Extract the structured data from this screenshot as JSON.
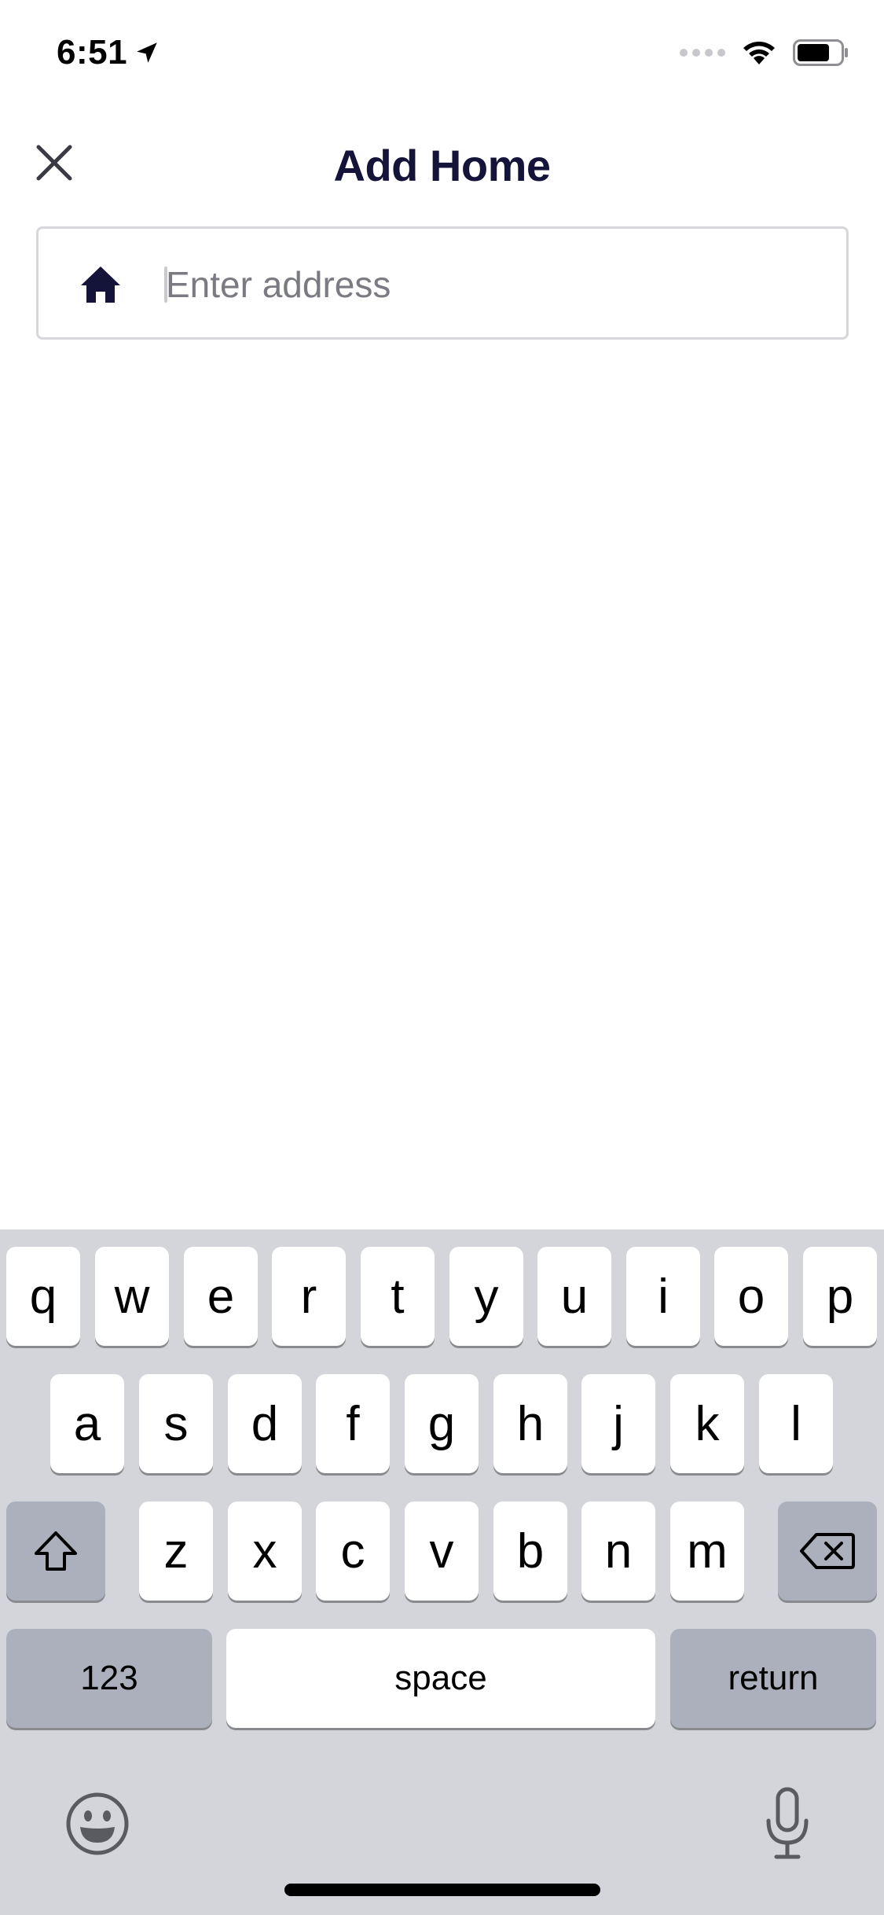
{
  "status_bar": {
    "time": "6:51"
  },
  "header": {
    "title": "Add Home"
  },
  "address": {
    "placeholder": "Enter address",
    "value": ""
  },
  "keyboard": {
    "row1": [
      "q",
      "w",
      "e",
      "r",
      "t",
      "y",
      "u",
      "i",
      "o",
      "p"
    ],
    "row2": [
      "a",
      "s",
      "d",
      "f",
      "g",
      "h",
      "j",
      "k",
      "l"
    ],
    "row3": [
      "z",
      "x",
      "c",
      "v",
      "b",
      "n",
      "m"
    ],
    "numbers_label": "123",
    "space_label": "space",
    "return_label": "return"
  },
  "icons": {
    "close": "close-icon",
    "home": "home-icon",
    "shift": "shift-icon",
    "delete": "delete-icon",
    "emoji": "emoji-icon",
    "microphone": "microphone-icon"
  },
  "colors": {
    "primary": "#14133a",
    "keyboard_bg": "#d3d5db",
    "key_bg": "#ffffff",
    "key_dark_bg": "#abb0bc"
  }
}
